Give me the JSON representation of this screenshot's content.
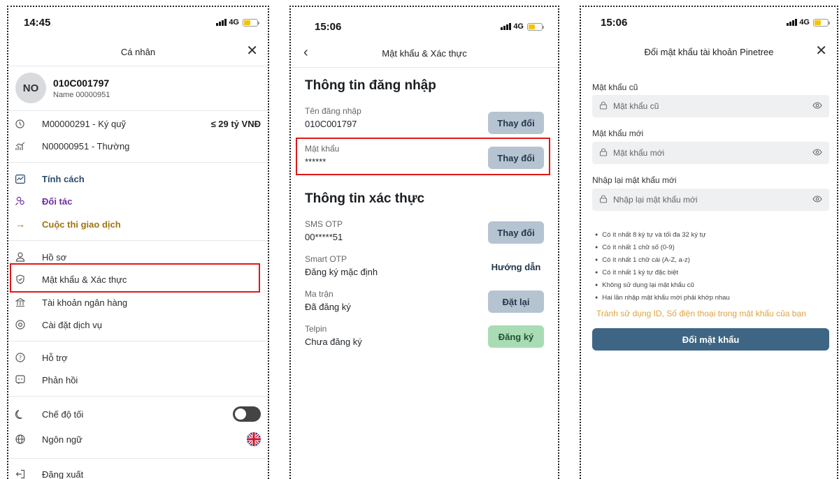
{
  "status_bars": [
    {
      "time": "14:45",
      "network": "4G"
    },
    {
      "time": "15:06",
      "network": "4G"
    },
    {
      "time": "15:06",
      "network": "4G"
    }
  ],
  "personal": {
    "title": "Cá nhân",
    "avatar_initials": "NO",
    "account_id": "010C001797",
    "account_name": "Name 00000951",
    "accounts": [
      {
        "label": "M00000291 - Ký quỹ",
        "value": "≤ 29 tỷ VNĐ",
        "icon": "clock-icon"
      },
      {
        "label": "N00000951 - Thường",
        "value": "",
        "icon": "chart-icon"
      }
    ],
    "features": [
      {
        "label": "Tính cách",
        "icon": "chart-box-icon",
        "color": "#2b4a6b"
      },
      {
        "label": "Đối tác",
        "icon": "partners-icon",
        "color": "#6b2fa0"
      },
      {
        "label": "Cuộc thi giao dịch",
        "icon": "arrow-right-icon",
        "color": "#a07410"
      }
    ],
    "settings": [
      {
        "label": "Hồ sơ",
        "icon": "user-icon"
      },
      {
        "label": "Mật khẩu & Xác thực",
        "icon": "shield-icon"
      },
      {
        "label": "Tài khoản ngân hàng",
        "icon": "bank-icon"
      },
      {
        "label": "Cài đặt dịch vụ",
        "icon": "settings-icon"
      }
    ],
    "support": [
      {
        "label": "Hỗ trợ",
        "icon": "help-icon"
      },
      {
        "label": "Phản hồi",
        "icon": "feedback-icon"
      }
    ],
    "dark_mode": {
      "label": "Chế độ tối",
      "enabled": false
    },
    "language": {
      "label": "Ngôn ngữ",
      "icon": "globe-icon",
      "flag": "uk-flag-icon"
    },
    "logout": {
      "label": "Đăng xuất",
      "icon": "logout-icon"
    }
  },
  "auth": {
    "title": "Mật khẩu & Xác thực",
    "login_section": "Thông tin đăng nhập",
    "username_label": "Tên đăng nhập",
    "username_value": "010C001797",
    "password_label": "Mật khẩu",
    "password_value": "******",
    "change_label": "Thay đổi",
    "verify_section": "Thông tin xác thực",
    "sms_label": "SMS OTP",
    "sms_value": "00*****51",
    "smart_label": "Smart OTP",
    "smart_value": "Đăng ký mặc định",
    "smart_action": "Hướng dẫn",
    "matrix_label": "Ma trận",
    "matrix_value": "Đã đăng ký",
    "matrix_action": "Đặt lại",
    "telpin_label": "Telpin",
    "telpin_value": "Chưa đăng ký",
    "telpin_action": "Đăng ký"
  },
  "change_password": {
    "title": "Đổi mật khẩu tài khoản Pinetree",
    "old_label": "Mật khẩu cũ",
    "old_placeholder": "Mật khẩu cũ",
    "new_label": "Mật khẩu mới",
    "new_placeholder": "Mật khẩu mới",
    "confirm_label": "Nhập lại mật khẩu mới",
    "confirm_placeholder": "Nhập lại mật khẩu mới",
    "rules": [
      "Có ít nhất 8 ký tự và tối đa 32 ký tự",
      "Có ít nhất 1 chữ số (0-9)",
      "Có ít nhất 1 chữ cái (A-Z, a-z)",
      "Có ít nhất 1 ký tự đặc biệt",
      "Không sử dụng lại mật khẩu cũ",
      "Hai lần nhập mật khẩu mới phải khớp nhau"
    ],
    "warning": "Tránh sử dụng ID, Số điện thoại trong mật khẩu của bạn",
    "submit_label": "Đổi mật khẩu"
  },
  "colors": {
    "highlight": "#e01818",
    "primary_button": "#3e6684",
    "secondary_button": "#b6c4d1",
    "success_button": "#a9dcb4",
    "warning_text": "#e0a23a"
  }
}
